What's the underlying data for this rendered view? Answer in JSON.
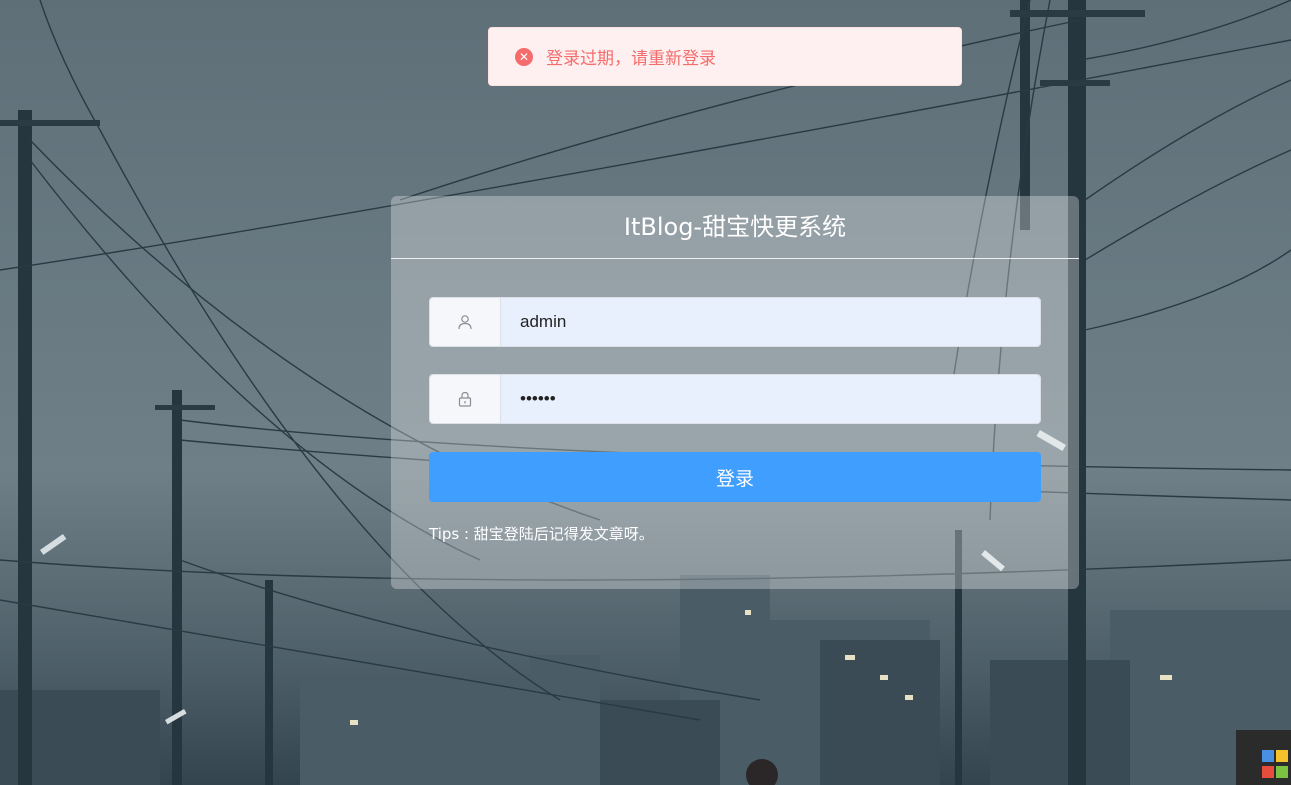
{
  "toast": {
    "message": "登录过期，请重新登录",
    "icon": "close-circle-icon",
    "color": "#f56c6c"
  },
  "login": {
    "title": "ItBlog-甜宝快更系统",
    "username": {
      "icon": "user-icon",
      "value": "admin"
    },
    "password": {
      "icon": "lock-icon",
      "value": "••••••"
    },
    "submit_label": "登录",
    "tips": "Tips : 甜宝登陆后记得发文章呀。",
    "accent_color": "#409eff"
  }
}
